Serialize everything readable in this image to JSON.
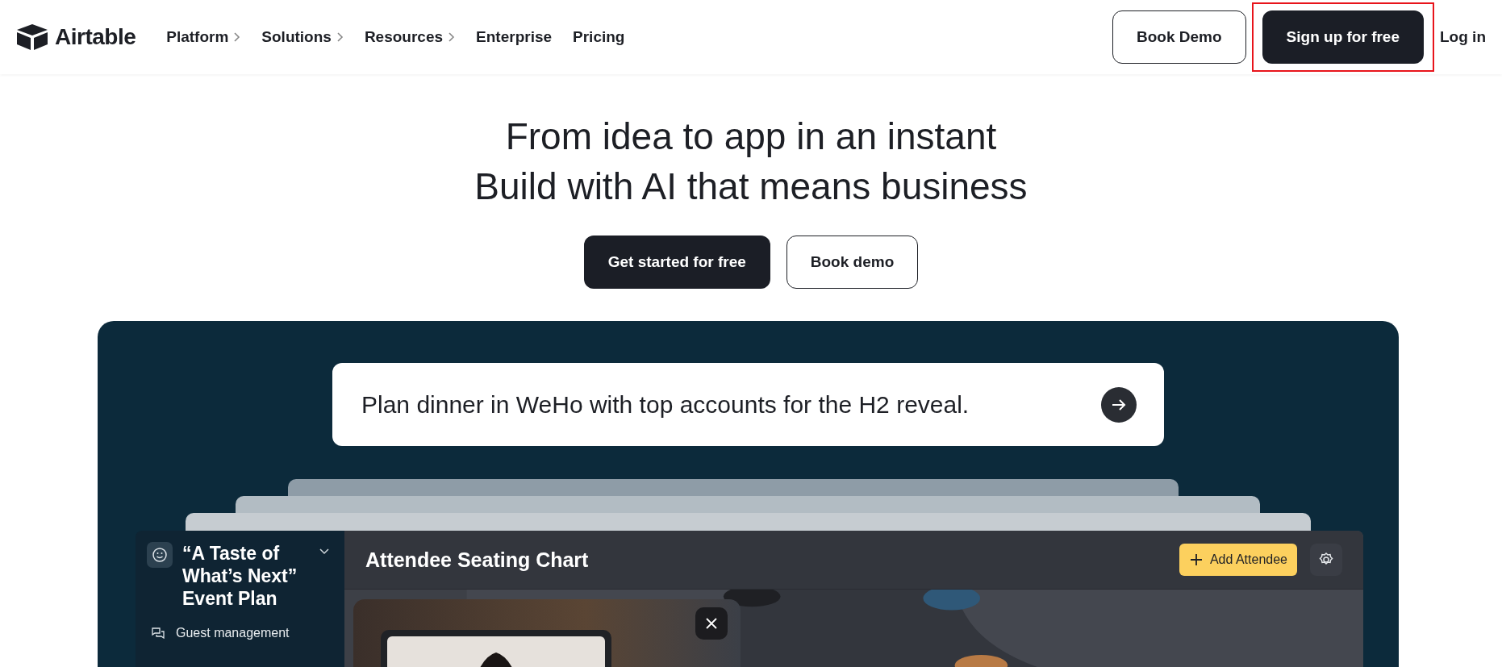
{
  "brand": {
    "name": "Airtable"
  },
  "nav": [
    {
      "label": "Platform",
      "has_menu": true
    },
    {
      "label": "Solutions",
      "has_menu": true
    },
    {
      "label": "Resources",
      "has_menu": true
    },
    {
      "label": "Enterprise",
      "has_menu": false
    },
    {
      "label": "Pricing",
      "has_menu": false
    }
  ],
  "header_actions": [
    {
      "label": "Book Demo",
      "kind": "outline",
      "highlighted": false
    },
    {
      "label": "Sign up for free",
      "kind": "solid",
      "highlighted": true
    },
    {
      "label": "Log in",
      "kind": "link",
      "highlighted": false
    }
  ],
  "hero": {
    "lines": [
      "From idea to app in an instant",
      "Build with AI that means business"
    ],
    "buttons": [
      {
        "label": "Get started for free",
        "kind": "solid"
      },
      {
        "label": "Book demo",
        "kind": "outline"
      }
    ]
  },
  "demo": {
    "prompt": "Plan dinner in WeHo with top accounts for the H2 reveal.",
    "app": {
      "base_title": "“A Taste of\nWhat’s Next”\nEvent Plan",
      "sidebar_items": [
        {
          "label": "Guest management"
        }
      ],
      "page_title": "Attendee Seating Chart",
      "primary_action": "Add Attendee"
    }
  }
}
